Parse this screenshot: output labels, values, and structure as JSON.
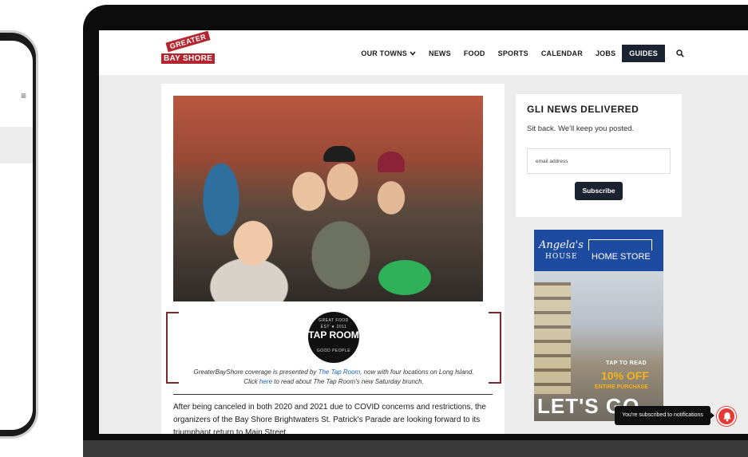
{
  "header": {
    "logo_top": "GREATER",
    "logo_bottom": "BAY SHORE",
    "nav": [
      {
        "label": "OUR TOWNS",
        "dropdown": true
      },
      {
        "label": "NEWS"
      },
      {
        "label": "FOOD"
      },
      {
        "label": "SPORTS"
      },
      {
        "label": "CALENDAR"
      },
      {
        "label": "JOBS"
      },
      {
        "label": "GUIDES",
        "active": true
      }
    ],
    "search_icon": "search-icon"
  },
  "article": {
    "sponsor": {
      "logo_top": "GREAT FOOD",
      "logo_est": "EST ★ 2011",
      "logo_main": "TAP ROOM",
      "logo_bottom": "GOOD PEOPLE",
      "text_1": "GreaterBayShore coverage is presented by ",
      "link_1": "The Tap Room",
      "text_2": ", now with four locations on Long Island.",
      "text_3": "Click ",
      "link_2": "here",
      "text_4": " to read about The Tap Room's new Saturday brunch."
    },
    "body": "After being canceled in both 2020 and 2021 due to COVID concerns and restrictions, the organizers of the Bay Shore Brightwaters St. Patrick's Parade are looking forward to its triumphant return to Main Street."
  },
  "signup": {
    "title": "GLI NEWS DELIVERED",
    "subtitle": "Sit back. We'll keep you posted.",
    "email_placeholder": "email address",
    "button": "Subscribe"
  },
  "ad": {
    "brand": "Angela's",
    "brand_sub": "HOUSE",
    "home_store": "HOME STORE",
    "tap_to_read": "TAP TO READ",
    "discount": "10% OFF",
    "entire": "ENTIRE PURCHASE",
    "cta": "LET'S GO SHOP"
  },
  "notification": {
    "tooltip": "You're subscribed to notifications"
  },
  "phone": {
    "menu_glyph": "≡"
  },
  "colors": {
    "brand_red": "#b3262f",
    "nav_dark": "#1b2230",
    "bracket": "#7a2a2a",
    "bell": "#e53935"
  }
}
